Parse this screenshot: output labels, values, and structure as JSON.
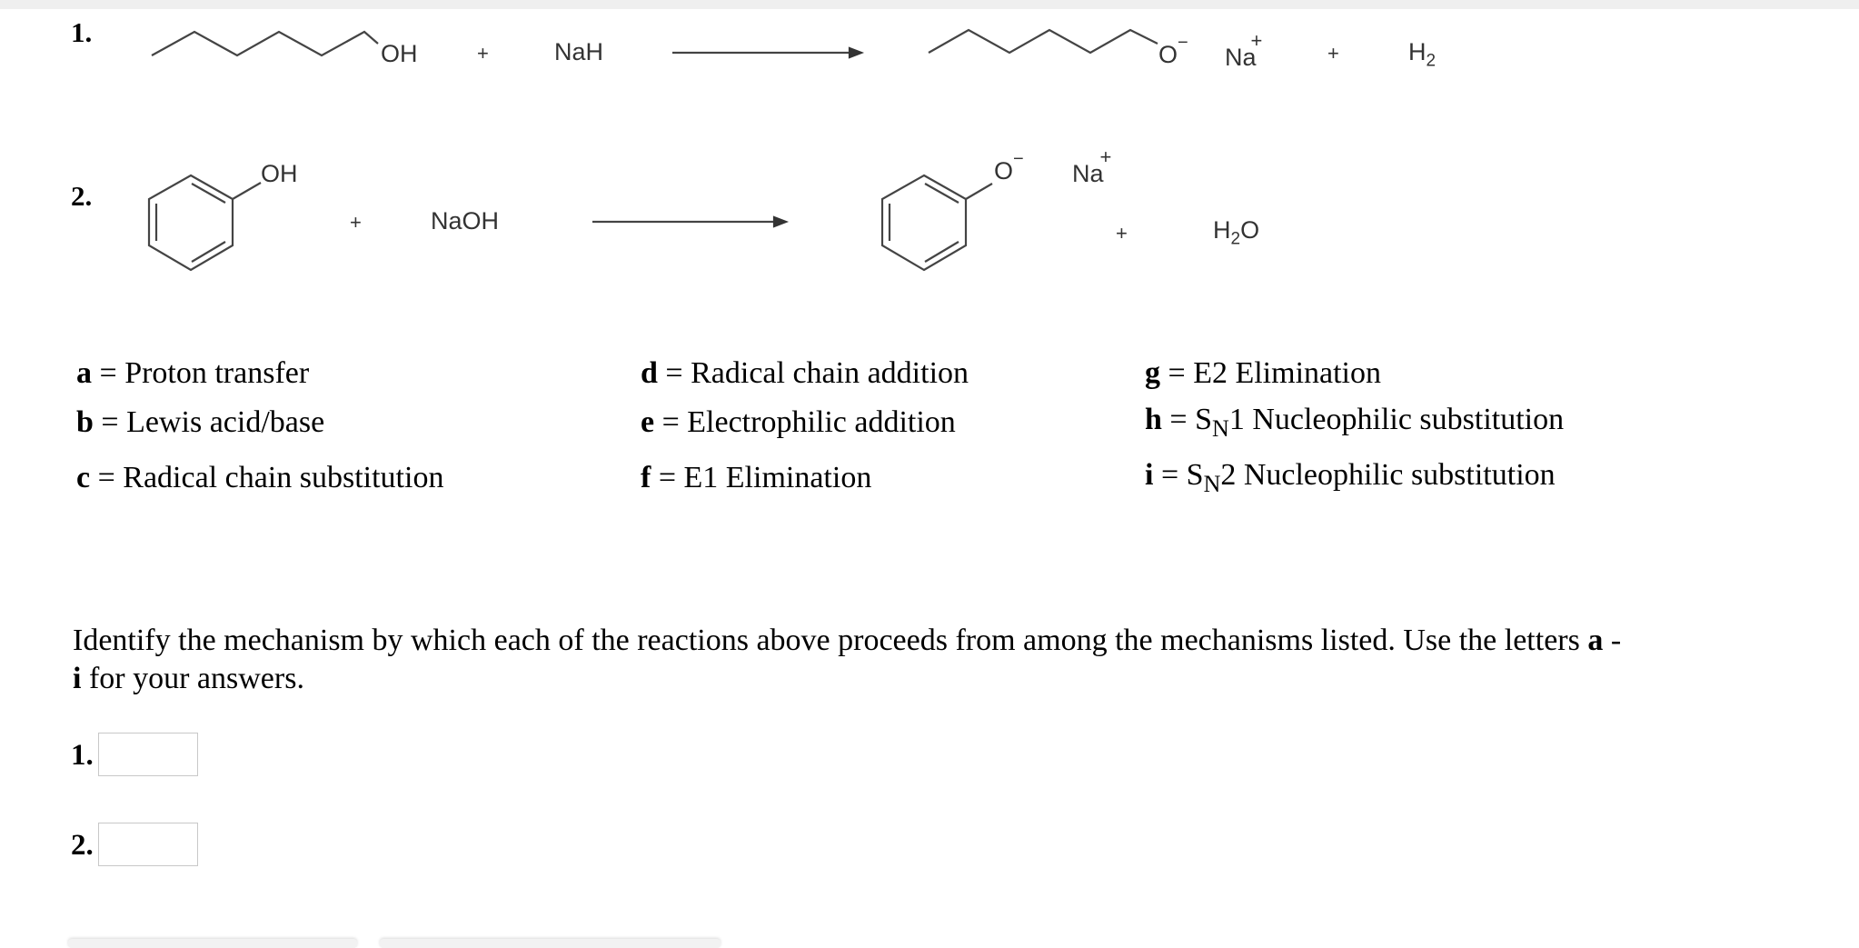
{
  "reactions": [
    {
      "number": "1.",
      "reactant1": {
        "name": "1-hexanol",
        "group": "OH"
      },
      "plus1": "+",
      "reagent": "NaH",
      "product1": {
        "name": "hexoxide",
        "group": "O",
        "charge": "−"
      },
      "counterion": {
        "symbol": "Na",
        "charge": "+"
      },
      "plus2": "+",
      "byproduct": {
        "main": "H",
        "sub": "2"
      }
    },
    {
      "number": "2.",
      "reactant1": {
        "name": "phenol",
        "group": "OH"
      },
      "plus1": "+",
      "reagent": "NaOH",
      "product1": {
        "name": "phenoxide",
        "group": "O",
        "charge": "−"
      },
      "counterion": {
        "symbol": "Na",
        "charge": "+"
      },
      "plus2": "+",
      "byproduct": {
        "main": "H",
        "sub": "2",
        "tail": "O"
      }
    }
  ],
  "mechanisms": [
    {
      "letter": "a",
      "eq": " = ",
      "text": "Proton transfer"
    },
    {
      "letter": "b",
      "eq": " = ",
      "text": "Lewis acid/base"
    },
    {
      "letter": "c",
      "eq": " = ",
      "text": "Radical chain substitution"
    },
    {
      "letter": "d",
      "eq": " = ",
      "text": "Radical chain addition"
    },
    {
      "letter": "e",
      "eq": " = ",
      "text": "Electrophilic addition"
    },
    {
      "letter": "f",
      "eq": " = ",
      "text": "E1 Elimination"
    },
    {
      "letter": "g",
      "eq": " = ",
      "text": "E2 Elimination"
    },
    {
      "letter": "h",
      "eq": " = ",
      "pre": "S",
      "sub": "N",
      "text": "1 Nucleophilic substitution"
    },
    {
      "letter": "i",
      "eq": " = ",
      "pre": "S",
      "sub": "N",
      "text": "2 Nucleophilic substitution"
    }
  ],
  "instructions": {
    "part1": "Identify the mechanism by which each of the reactions above proceeds from among the mechanisms listed. Use the letters ",
    "bold1": "a",
    "mid": " - ",
    "bold2": "i",
    "part2": " for your answers."
  },
  "answers": [
    {
      "label": "1.",
      "value": ""
    },
    {
      "label": "2.",
      "value": ""
    }
  ]
}
